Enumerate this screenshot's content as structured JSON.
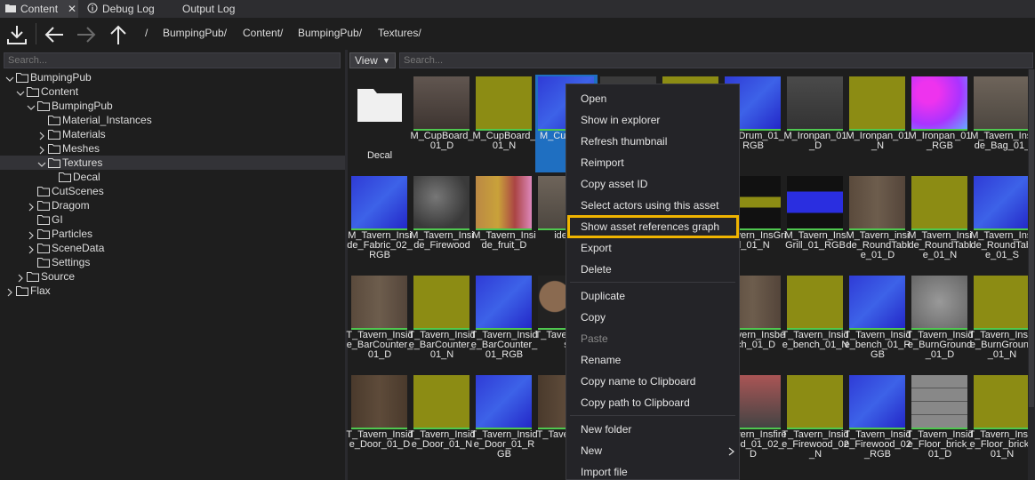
{
  "tabs": [
    {
      "label": "Content",
      "icon": "folder-icon"
    },
    {
      "label": "Debug Log",
      "icon": "info-icon"
    },
    {
      "label": "Output Log",
      "icon": ""
    }
  ],
  "breadcrumb": {
    "sep": "/",
    "parts": [
      "BumpingPub/",
      "Content/",
      "BumpingPub/",
      "Textures/"
    ]
  },
  "tree": {
    "search_placeholder": "Search...",
    "nodes": [
      "BumpingPub",
      "Content",
      "BumpingPub",
      "Material_Instances",
      "Materials",
      "Meshes",
      "Textures",
      "Decal",
      "CutScenes",
      "Dragom",
      "GI",
      "Particles",
      "SceneData",
      "Settings",
      "Source",
      "Flax"
    ]
  },
  "grid": {
    "view_label": "View",
    "search_placeholder": "Search...",
    "items": [
      {
        "caption": "Decal",
        "thumb": "folder"
      },
      {
        "caption": "M_CupBoard_01_D",
        "thumb": "cupboard"
      },
      {
        "caption": "M_CupBoard_01_N",
        "thumb": "normal"
      },
      {
        "caption": "M_Cup_01_",
        "thumb": "blue"
      },
      {
        "caption": "",
        "thumb": "dark"
      },
      {
        "caption": "",
        "thumb": "normal"
      },
      {
        "caption": "ironDrum_01_RGB",
        "thumb": "blue"
      },
      {
        "caption": "M_Ironpan_01_D",
        "thumb": "gray"
      },
      {
        "caption": "M_Ironpan_01_N",
        "thumb": "normal"
      },
      {
        "caption": "M_Ironpan_01_RGB",
        "thumb": "magenta"
      },
      {
        "caption": "M_Tavern_Inside_Bag_01_",
        "thumb": "brown"
      },
      {
        "caption": "M_Tavern_Inside_Fabric_02_RGB",
        "thumb": "blue"
      },
      {
        "caption": "M_Tavern_Inside_Firewood",
        "thumb": "cloud"
      },
      {
        "caption": "M_Tavern_Inside_fruit_D",
        "thumb": "fruit"
      },
      {
        "caption": "ide_fr",
        "thumb": "brown"
      },
      {
        "caption": "",
        "thumb": "dark"
      },
      {
        "caption": "",
        "thumb": "normal"
      },
      {
        "caption": "_Tavern_InsGrill_01_N",
        "thumb": "greenline"
      },
      {
        "caption": "M_Tavern_InsGrill_01_RGB",
        "thumb": "blueline"
      },
      {
        "caption": "M_Tavern_inside_RoundTable_01_D",
        "thumb": "wood"
      },
      {
        "caption": "M_Tavern_Inside_RoundTable_01_N",
        "thumb": "normal"
      },
      {
        "caption": "M_Tavern_Inside_RoundTable_01_S",
        "thumb": "blue"
      },
      {
        "caption": "T_Tavern_Inside_BarCounter_01_D",
        "thumb": "wood"
      },
      {
        "caption": "T_Tavern_Inside_BarCounter_01_N",
        "thumb": "normal"
      },
      {
        "caption": "T_Tavern_Inside_BarCounter_01_RGB",
        "thumb": "blue"
      },
      {
        "caption": "T_Tave de_Bas",
        "thumb": "barrel"
      },
      {
        "caption": "",
        "thumb": "dark"
      },
      {
        "caption": "",
        "thumb": "normal"
      },
      {
        "caption": "_Tavern_Insbench_01_D",
        "thumb": "wood"
      },
      {
        "caption": "T_Tavern_Inside_bench_01_N",
        "thumb": "normal"
      },
      {
        "caption": "T_Tavern_Inside_bench_01_RGB",
        "thumb": "blue"
      },
      {
        "caption": "T_Tavern_Inside_BurnGround_01_D",
        "thumb": "stone"
      },
      {
        "caption": "T_Tavern_Inside_BurnGround_01_N",
        "thumb": "normal"
      },
      {
        "caption": "T_Tavern_Inside_Door_01_D",
        "thumb": "door"
      },
      {
        "caption": "T_Tavern_Inside_Door_01_N",
        "thumb": "normal"
      },
      {
        "caption": "T_Tavern_Inside_Door_01_RGB",
        "thumb": "blue"
      },
      {
        "caption": "T_Tave de_Fi",
        "thumb": "door"
      },
      {
        "caption": "",
        "thumb": "dark"
      },
      {
        "caption": "",
        "thumb": "normal"
      },
      {
        "caption": "_Tavern_Insfirewood_01_02_D",
        "thumb": "fire"
      },
      {
        "caption": "T_Tavern_Inside_Firewood_02_N",
        "thumb": "normal"
      },
      {
        "caption": "T_Tavern_Inside_Firewood_02_RGB",
        "thumb": "blue"
      },
      {
        "caption": "T_Tavern_Inside_Floor_brick_01_D",
        "thumb": "tiles"
      },
      {
        "caption": "T_Tavern_Inside_Floor_brick_01_N",
        "thumb": "normal"
      }
    ]
  },
  "context_menu": {
    "items": [
      {
        "label": "Open"
      },
      {
        "label": "Show in explorer"
      },
      {
        "label": "Refresh thumbnail"
      },
      {
        "label": "Reimport"
      },
      {
        "label": "Copy asset ID"
      },
      {
        "label": "Select actors using this asset"
      },
      {
        "label": "Show asset references graph",
        "highlighted": true
      },
      {
        "label": "Export"
      },
      {
        "label": "Delete"
      },
      {
        "label": "Duplicate"
      },
      {
        "label": "Copy"
      },
      {
        "label": "Paste",
        "disabled": true
      },
      {
        "label": "Rename"
      },
      {
        "label": "Copy name to Clipboard"
      },
      {
        "label": "Copy path to Clipboard"
      },
      {
        "label": "New folder"
      },
      {
        "label": "New",
        "submenu": true
      },
      {
        "label": "Import file"
      }
    ]
  },
  "colors": {
    "highlight": "#f0b400",
    "selection": "#1f6fc1",
    "normal_map": "#8c8c14",
    "rgb_map": "#2a2ee0",
    "status_bar": "#4fc74f"
  }
}
